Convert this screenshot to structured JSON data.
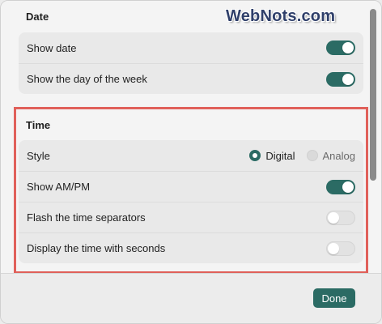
{
  "watermark": "WebNots.com",
  "date_section": {
    "title": "Date",
    "rows": [
      {
        "label": "Show date",
        "toggle": "on"
      },
      {
        "label": "Show the day of the week",
        "toggle": "on"
      }
    ]
  },
  "time_section": {
    "title": "Time",
    "style_label": "Style",
    "style_options": [
      {
        "label": "Digital",
        "selected": true
      },
      {
        "label": "Analog",
        "selected": false
      }
    ],
    "rows": [
      {
        "label": "Show AM/PM",
        "toggle": "on"
      },
      {
        "label": "Flash the time separators",
        "toggle": "off"
      },
      {
        "label": "Display the time with seconds",
        "toggle": "off"
      }
    ]
  },
  "footer": {
    "done_label": "Done"
  },
  "colors": {
    "accent": "#2b6b64",
    "highlight": "#e0605a"
  }
}
